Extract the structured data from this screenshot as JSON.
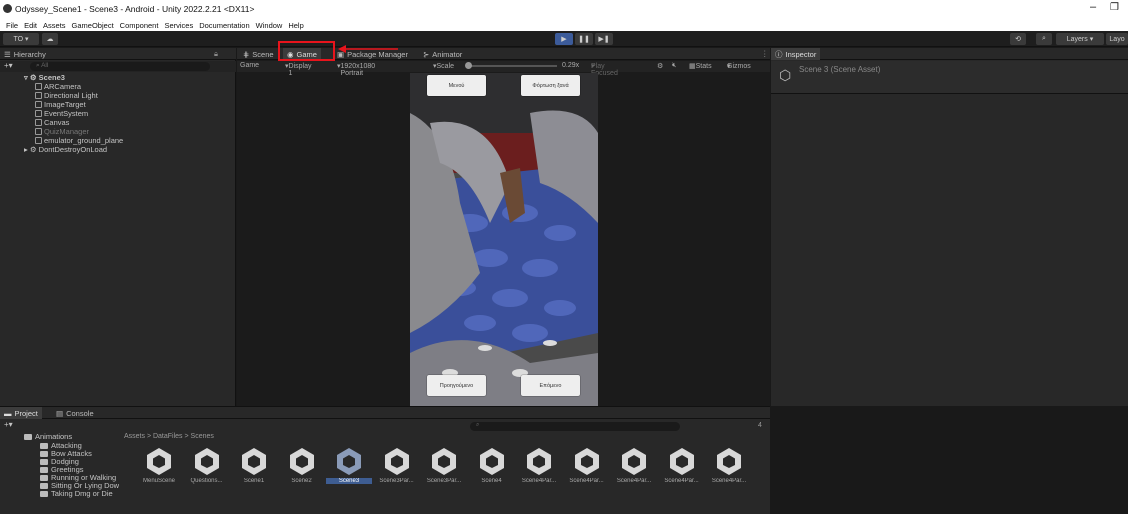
{
  "window": {
    "title": "Odyssey_Scene1 - Scene3 - Android - Unity 2022.2.21 <DX11>"
  },
  "menu": [
    "File",
    "Edit",
    "Assets",
    "GameObject",
    "Component",
    "Services",
    "Documentation",
    "Window",
    "Help"
  ],
  "toolbar": {
    "account": "TO ▾",
    "layers": "Layers",
    "layout": "Layo"
  },
  "hierarchy": {
    "tab": "Hierarchy",
    "search_placeholder": "All",
    "items": [
      {
        "label": "Scene3"
      },
      {
        "label": "ARCamera"
      },
      {
        "label": "Directional Light"
      },
      {
        "label": "ImageTarget"
      },
      {
        "label": "EventSystem"
      },
      {
        "label": "Canvas"
      },
      {
        "label": "QuizManager"
      },
      {
        "label": "emulator_ground_plane"
      },
      {
        "label": "DontDestroyOnLoad"
      }
    ]
  },
  "center_tabs": {
    "scene": "Scene",
    "game": "Game",
    "package_manager": "Package Manager",
    "animator": "Animator"
  },
  "game_controls": {
    "mode": "Game",
    "display": "Display 1",
    "resolution": "1920x1080 Portrait",
    "scale_label": "Scale",
    "scale_value": "0.29x",
    "play_focused": "Play Focused",
    "stats": "Stats",
    "gizmos": "Gizmos"
  },
  "game_buttons": {
    "menu": "Μενού",
    "charge": "Φόρτωση ξανά",
    "prev": "Προηγούμενο",
    "next": "Επόμενο"
  },
  "inspector": {
    "tab": "Inspector",
    "title": "Scene 3 (Scene Asset)"
  },
  "project": {
    "tab_project": "Project",
    "tab_console": "Console",
    "breadcrumb": "Assets > DataFiles > Scenes",
    "folders": [
      {
        "label": "Animations"
      },
      {
        "label": "Attacking"
      },
      {
        "label": "Bow Attacks"
      },
      {
        "label": "Dodging"
      },
      {
        "label": "Greetings"
      },
      {
        "label": "Running or Walking"
      },
      {
        "label": "Sitting Or Lying Dow"
      },
      {
        "label": "Taking Dmg or Die"
      }
    ],
    "assets": [
      {
        "label": "MenuScene"
      },
      {
        "label": "Questions..."
      },
      {
        "label": "Scene1"
      },
      {
        "label": "Scene2"
      },
      {
        "label": "Scene3"
      },
      {
        "label": "Scene3Par..."
      },
      {
        "label": "Scene3Par..."
      },
      {
        "label": "Scene4"
      },
      {
        "label": "Scene4Par..."
      },
      {
        "label": "Scene4Par..."
      },
      {
        "label": "Scene4Par..."
      },
      {
        "label": "Scene4Par..."
      },
      {
        "label": "Scene4Par..."
      }
    ],
    "count_badge": "4"
  },
  "colors": {
    "accent": "#3c5b9a",
    "highlight": "#e8141c"
  }
}
